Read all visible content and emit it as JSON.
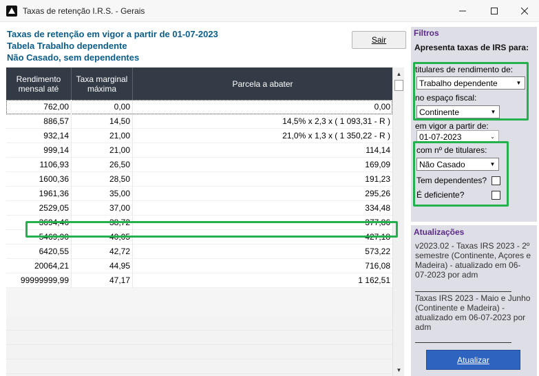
{
  "window": {
    "title": "Taxas de retenção I.R.S. - Gerais",
    "controls": {
      "minimize": "—",
      "maximize": "☐",
      "close": "✕"
    }
  },
  "header": {
    "line1": "Taxas de retenção em vigor a partir de 01-07-2023",
    "line2": "Tabela Trabalho dependente",
    "line3": "Não Casado, sem dependentes",
    "exit_button": "Sair"
  },
  "table": {
    "columns": [
      "Rendimento mensal até",
      "Taxa marginal máxima",
      "Parcela a abater"
    ],
    "rows": [
      [
        "762,00",
        "0,00",
        "0,00"
      ],
      [
        "886,57",
        "14,50",
        "14,5% x 2,3 x ( 1 093,31 - R )"
      ],
      [
        "932,14",
        "21,00",
        "21,0% x 1,3 x ( 1 350,22 - R )"
      ],
      [
        "999,14",
        "21,00",
        "114,14"
      ],
      [
        "1106,93",
        "26,50",
        "169,09"
      ],
      [
        "1600,36",
        "28,50",
        "191,23"
      ],
      [
        "1961,36",
        "35,00",
        "295,26"
      ],
      [
        "2529,05",
        "37,00",
        "334,48"
      ],
      [
        "3694,46",
        "38,72",
        "377,86"
      ],
      [
        "5469,90",
        "40,05",
        "427,18"
      ],
      [
        "6420,55",
        "42,72",
        "573,22"
      ],
      [
        "20064,21",
        "44,95",
        "716,08"
      ],
      [
        "99999999,99",
        "47,17",
        "1 162,51"
      ]
    ]
  },
  "filters": {
    "title": "Filtros",
    "subtitle": "Apresenta taxas de IRS para:",
    "titulares_label": "titulares de rendimento de:",
    "titulares_value": "Trabalho dependente",
    "espaco_label": "no espaço fiscal:",
    "espaco_value": "Continente",
    "vigor_label": "em vigor a partir de:",
    "vigor_value": "01-07-2023",
    "num_titulares_label": "com nº de titulares:",
    "num_titulares_value": "Não Casado",
    "dependentes_label": "Tem dependentes?",
    "dependentes_checked": false,
    "deficiente_label": "É deficiente?",
    "deficiente_checked": false
  },
  "updates": {
    "title": "Atualizações",
    "entry1": "v2023.02 - Taxas IRS 2023 - 2º semestre (Continente, Açores e Madeira) - atualizado em 06-07-2023 por adm",
    "entry2": "Taxas IRS 2023 - Maio e Junho (Continente e Madeira) - atualizado em 06-07-2023 por adm",
    "button": "Atualizar"
  },
  "colors": {
    "header_text": "#0a5d8a",
    "section_title": "#5b2a86",
    "table_header_bg": "#333c46",
    "highlight": "#22b14c",
    "primary_button": "#2e64c0"
  }
}
